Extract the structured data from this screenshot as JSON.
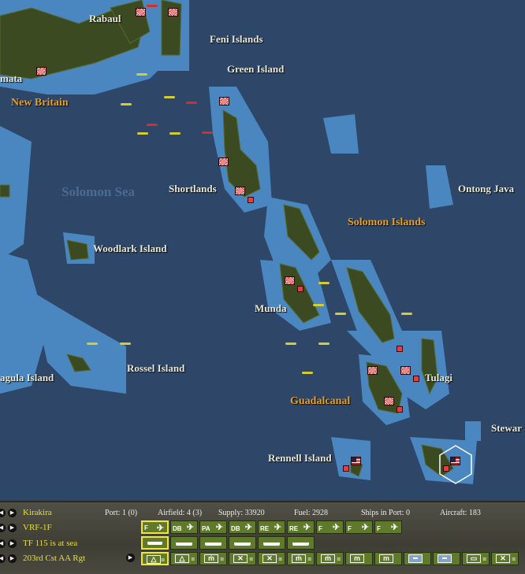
{
  "map": {
    "labels": {
      "rabaul": "Rabaul",
      "feni": "Feni Islands",
      "green": "Green Island",
      "mata": "mata",
      "new_britain": "New Britain",
      "solomon_sea": "Solomon Sea",
      "shortlands": "Shortlands",
      "ontong_java": "Ontong Java",
      "solomon_islands": "Solomon Islands",
      "woodlark": "Woodlark Island",
      "munda": "Munda",
      "rossel": "Rossel Island",
      "agula": "agula Island",
      "tulagi": "Tulagi",
      "guadalcanal": "Guadalcanal",
      "stewart": "Stewar",
      "rennell": "Rennell Island"
    },
    "colors": {
      "deep": "#2e4769",
      "shallow": "#4a86bf",
      "land": "#3c4a22",
      "japan": "#d01010",
      "allied_plane": "#d4cc30"
    }
  },
  "panel": {
    "base_name": "Kirakira",
    "air_unit": "VRF-1F",
    "task_force": "TF 115 is at sea",
    "ground_unit": "203rd Cst AA Rgt",
    "stats": {
      "port": "Port: 1 (0)",
      "airfield": "Airfield: 4 (3)",
      "supply": "Supply: 33920",
      "fuel": "Fuel: 2928",
      "ships": "Ships in Port: 0",
      "aircraft": "Aircraft: 183"
    },
    "air_buttons": [
      "F",
      "DB",
      "PA",
      "DB",
      "RE",
      "RE",
      "F",
      "F",
      "F"
    ],
    "ship_buttons": [
      "ship-1",
      "ship-2",
      "ship-3",
      "ship-4",
      "ship-5",
      "ship-6"
    ],
    "ground_buttons": [
      {
        "sym": "△",
        "eq": "="
      },
      {
        "sym": "△",
        "eq": "="
      },
      {
        "sym": "ṁ",
        "eq": "="
      },
      {
        "sym": "✕",
        "eq": "="
      },
      {
        "sym": "✕",
        "eq": "="
      },
      {
        "sym": "ṁ",
        "eq": "="
      },
      {
        "sym": "ṁ",
        "eq": "="
      },
      {
        "sym": "m",
        "eq": ""
      },
      {
        "sym": "m",
        "eq": ""
      },
      {
        "sym": "━",
        "eq": "",
        "blue": true
      },
      {
        "sym": "━",
        "eq": "",
        "blue": true
      },
      {
        "sym": "▭",
        "eq": "="
      },
      {
        "sym": "✕",
        "eq": "="
      }
    ]
  }
}
